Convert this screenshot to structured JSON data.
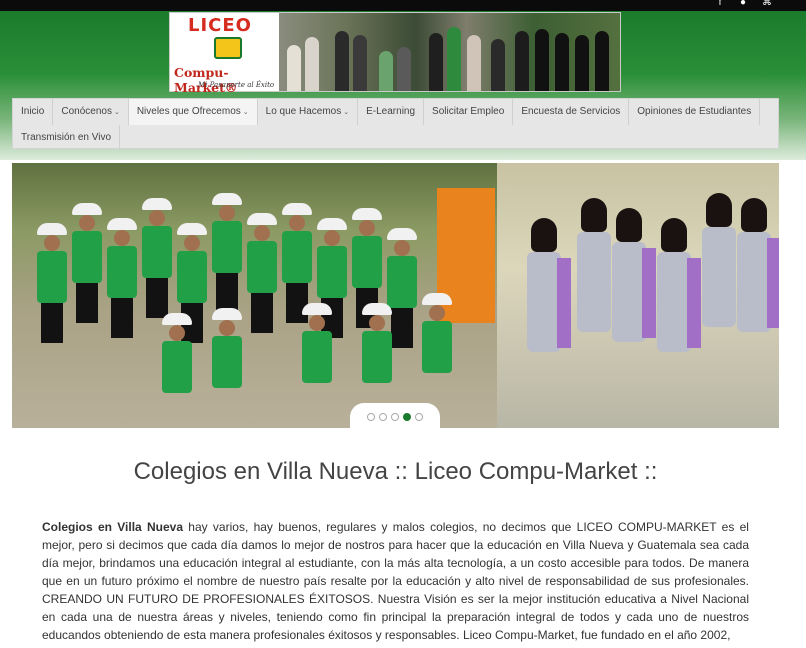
{
  "social": {
    "facebook": "f",
    "profile": "●",
    "rss": "⌘"
  },
  "logo": {
    "word1": "LICEO",
    "word2": "Compu-Market®",
    "tagline": "Mi Pasaporte al Éxito"
  },
  "nav": {
    "row1": [
      {
        "label": "Inicio",
        "dropdown": false
      },
      {
        "label": "Conócenos",
        "dropdown": true
      },
      {
        "label": "Niveles que Ofrecemos",
        "dropdown": true
      },
      {
        "label": "Lo que Hacemos",
        "dropdown": true
      },
      {
        "label": "E-Learning",
        "dropdown": false
      },
      {
        "label": "Solicitar Empleo",
        "dropdown": false
      },
      {
        "label": "Encuesta de Servicios",
        "dropdown": false
      },
      {
        "label": "Opiniones de Estudiantes",
        "dropdown": false
      }
    ],
    "row2": [
      {
        "label": "Transmisión en Vivo",
        "dropdown": false
      }
    ]
  },
  "slider": {
    "dots": 5,
    "active_index": 3
  },
  "content": {
    "title": "Colegios en Villa Nueva :: Liceo Compu-Market ::",
    "lead": "Colegios en Villa Nueva",
    "body": " hay varios, hay buenos, regulares y malos colegios, no decimos que LICEO COMPU-MARKET es el mejor, pero si decimos que cada día damos lo mejor de nostros para hacer que la educación en Villa Nueva y Guatemala sea cada día mejor, brindamos una educación integral al estudiante, con la más alta tecnología, a un costo accesible para todos. De manera que en un futuro próximo el nombre de nuestro país resalte por la educación y alto nivel de responsabilidad de sus profesionales. CREANDO UN FUTURO DE PROFESIONALES ÉXITOSOS. Nuestra Visión es ser la mejor institución educativa a Nivel Nacional en cada una de nuestra áreas y niveles, teniendo como fin principal la preparación integral de todos y cada uno de nuestros educandos obteniendo de esta manera profesionales éxitosos y responsables. Liceo Compu-Market, fue fundado en el año 2002,"
  }
}
